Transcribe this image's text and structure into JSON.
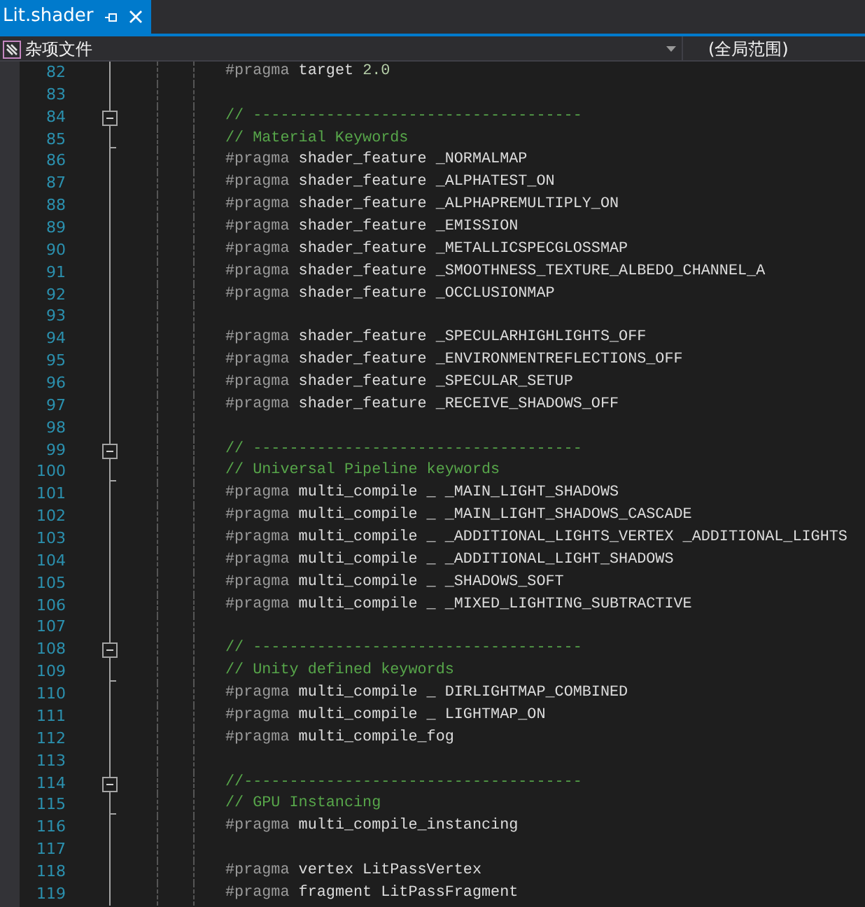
{
  "tab": {
    "title": "Lit.shader",
    "selected": true
  },
  "navbar": {
    "project": "杂项文件",
    "scope": "(全局范围)"
  },
  "lines": [
    {
      "number": "82",
      "segments": [
        {
          "kind": "directive",
          "text": "#pragma"
        },
        {
          "kind": "plain",
          "text": "target"
        },
        {
          "kind": "number",
          "text": "2.0"
        }
      ]
    },
    {
      "number": "83"
    },
    {
      "number": "84",
      "fold_start": true,
      "expanded": true,
      "segments": [
        {
          "kind": "comment",
          "text": "// ------------------------------------"
        }
      ]
    },
    {
      "number": "85",
      "fold_end": true,
      "segments": [
        {
          "kind": "comment",
          "text": "// Material Keywords"
        }
      ]
    },
    {
      "number": "86",
      "segments": [
        {
          "kind": "directive",
          "text": "#pragma"
        },
        {
          "kind": "plain",
          "text": "shader_feature _NORMALMAP"
        }
      ]
    },
    {
      "number": "87",
      "segments": [
        {
          "kind": "directive",
          "text": "#pragma"
        },
        {
          "kind": "plain",
          "text": "shader_feature _ALPHATEST_ON"
        }
      ]
    },
    {
      "number": "88",
      "segments": [
        {
          "kind": "directive",
          "text": "#pragma"
        },
        {
          "kind": "plain",
          "text": "shader_feature _ALPHAPREMULTIPLY_ON"
        }
      ]
    },
    {
      "number": "89",
      "segments": [
        {
          "kind": "directive",
          "text": "#pragma"
        },
        {
          "kind": "plain",
          "text": "shader_feature _EMISSION"
        }
      ]
    },
    {
      "number": "90",
      "segments": [
        {
          "kind": "directive",
          "text": "#pragma"
        },
        {
          "kind": "plain",
          "text": "shader_feature _METALLICSPECGLOSSMAP"
        }
      ]
    },
    {
      "number": "91",
      "segments": [
        {
          "kind": "directive",
          "text": "#pragma"
        },
        {
          "kind": "plain",
          "text": "shader_feature _SMOOTHNESS_TEXTURE_ALBEDO_CHANNEL_A"
        }
      ]
    },
    {
      "number": "92",
      "segments": [
        {
          "kind": "directive",
          "text": "#pragma"
        },
        {
          "kind": "plain",
          "text": "shader_feature _OCCLUSIONMAP"
        }
      ]
    },
    {
      "number": "93"
    },
    {
      "number": "94",
      "segments": [
        {
          "kind": "directive",
          "text": "#pragma"
        },
        {
          "kind": "plain",
          "text": "shader_feature _SPECULARHIGHLIGHTS_OFF"
        }
      ]
    },
    {
      "number": "95",
      "segments": [
        {
          "kind": "directive",
          "text": "#pragma"
        },
        {
          "kind": "plain",
          "text": "shader_feature _ENVIRONMENTREFLECTIONS_OFF"
        }
      ]
    },
    {
      "number": "96",
      "segments": [
        {
          "kind": "directive",
          "text": "#pragma"
        },
        {
          "kind": "plain",
          "text": "shader_feature _SPECULAR_SETUP"
        }
      ]
    },
    {
      "number": "97",
      "segments": [
        {
          "kind": "directive",
          "text": "#pragma"
        },
        {
          "kind": "plain",
          "text": "shader_feature _RECEIVE_SHADOWS_OFF"
        }
      ]
    },
    {
      "number": "98"
    },
    {
      "number": "99",
      "fold_start": true,
      "expanded": true,
      "segments": [
        {
          "kind": "comment",
          "text": "// ------------------------------------"
        }
      ]
    },
    {
      "number": "100",
      "fold_end": true,
      "segments": [
        {
          "kind": "comment",
          "text": "// Universal Pipeline keywords"
        }
      ]
    },
    {
      "number": "101",
      "segments": [
        {
          "kind": "directive",
          "text": "#pragma"
        },
        {
          "kind": "plain",
          "text": "multi_compile _ _MAIN_LIGHT_SHADOWS"
        }
      ]
    },
    {
      "number": "102",
      "segments": [
        {
          "kind": "directive",
          "text": "#pragma"
        },
        {
          "kind": "plain",
          "text": "multi_compile _ _MAIN_LIGHT_SHADOWS_CASCADE"
        }
      ]
    },
    {
      "number": "103",
      "segments": [
        {
          "kind": "directive",
          "text": "#pragma"
        },
        {
          "kind": "plain",
          "text": "multi_compile _ _ADDITIONAL_LIGHTS_VERTEX _ADDITIONAL_LIGHTS"
        }
      ]
    },
    {
      "number": "104",
      "segments": [
        {
          "kind": "directive",
          "text": "#pragma"
        },
        {
          "kind": "plain",
          "text": "multi_compile _ _ADDITIONAL_LIGHT_SHADOWS"
        }
      ]
    },
    {
      "number": "105",
      "segments": [
        {
          "kind": "directive",
          "text": "#pragma"
        },
        {
          "kind": "plain",
          "text": "multi_compile _ _SHADOWS_SOFT"
        }
      ]
    },
    {
      "number": "106",
      "segments": [
        {
          "kind": "directive",
          "text": "#pragma"
        },
        {
          "kind": "plain",
          "text": "multi_compile _ _MIXED_LIGHTING_SUBTRACTIVE"
        }
      ]
    },
    {
      "number": "107"
    },
    {
      "number": "108",
      "fold_start": true,
      "expanded": true,
      "segments": [
        {
          "kind": "comment",
          "text": "// ------------------------------------"
        }
      ]
    },
    {
      "number": "109",
      "fold_end": true,
      "segments": [
        {
          "kind": "comment",
          "text": "// Unity defined keywords"
        }
      ]
    },
    {
      "number": "110",
      "segments": [
        {
          "kind": "directive",
          "text": "#pragma"
        },
        {
          "kind": "plain",
          "text": "multi_compile _ DIRLIGHTMAP_COMBINED"
        }
      ]
    },
    {
      "number": "111",
      "segments": [
        {
          "kind": "directive",
          "text": "#pragma"
        },
        {
          "kind": "plain",
          "text": "multi_compile _ LIGHTMAP_ON"
        }
      ]
    },
    {
      "number": "112",
      "segments": [
        {
          "kind": "directive",
          "text": "#pragma"
        },
        {
          "kind": "plain",
          "text": "multi_compile_fog"
        }
      ]
    },
    {
      "number": "113"
    },
    {
      "number": "114",
      "fold_start": true,
      "expanded": true,
      "segments": [
        {
          "kind": "comment",
          "text": "//-------------------------------------"
        }
      ]
    },
    {
      "number": "115",
      "fold_end": true,
      "segments": [
        {
          "kind": "comment",
          "text": "// GPU Instancing"
        }
      ]
    },
    {
      "number": "116",
      "segments": [
        {
          "kind": "directive",
          "text": "#pragma"
        },
        {
          "kind": "plain",
          "text": "multi_compile_instancing"
        }
      ]
    },
    {
      "number": "117"
    },
    {
      "number": "118",
      "segments": [
        {
          "kind": "directive",
          "text": "#pragma"
        },
        {
          "kind": "plain",
          "text": "vertex LitPassVertex"
        }
      ]
    },
    {
      "number": "119",
      "segments": [
        {
          "kind": "directive",
          "text": "#pragma"
        },
        {
          "kind": "plain",
          "text": "fragment LitPassFragment"
        }
      ]
    }
  ]
}
